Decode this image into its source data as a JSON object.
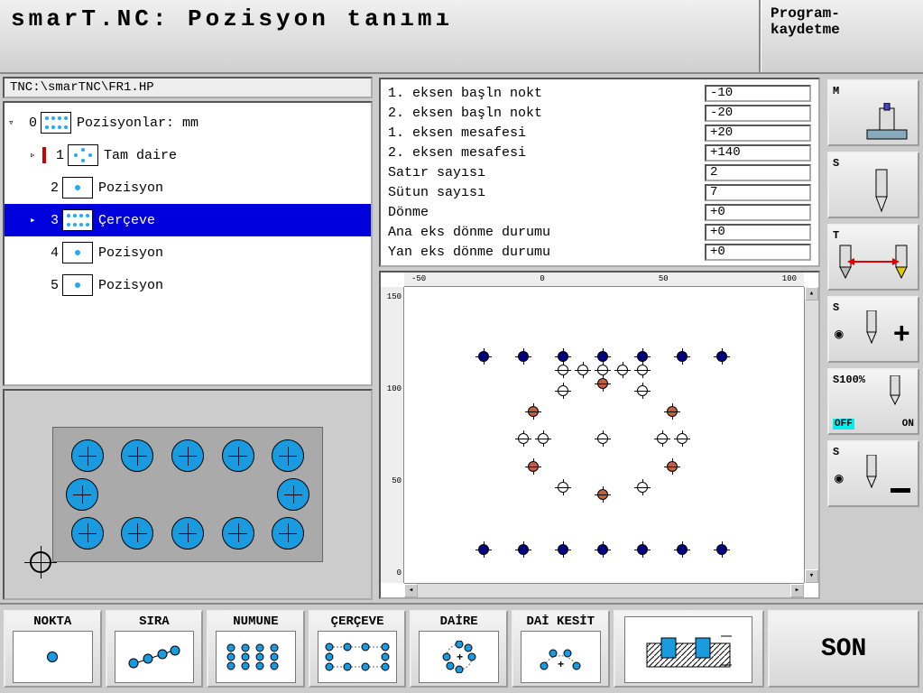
{
  "title": "smarT.NC: Pozisyon tanımı",
  "header_button": "Program-\nkaydetme",
  "path": "TNC:\\smarTNC\\FR1.HP",
  "tree": [
    {
      "num": "0",
      "label": "Pozisyonlar: mm",
      "expandable": true,
      "selected": false,
      "top": true
    },
    {
      "num": "1",
      "label": "Tam daire",
      "redmark": true
    },
    {
      "num": "2",
      "label": "Pozisyon"
    },
    {
      "num": "3",
      "label": "Çerçeve",
      "selected": true
    },
    {
      "num": "4",
      "label": "Pozisyon"
    },
    {
      "num": "5",
      "label": "Pozisyon"
    }
  ],
  "params": [
    {
      "label": "1. eksen başln nokt",
      "value": "-10"
    },
    {
      "label": "2. eksen başln nokt",
      "value": "-20"
    },
    {
      "label": "1. eksen mesafesi",
      "value": "+20"
    },
    {
      "label": "2. eksen mesafesi",
      "value": "+140"
    },
    {
      "label": "Satır sayısı",
      "value": "2"
    },
    {
      "label": "Sütun sayısı",
      "value": "7"
    },
    {
      "label": "Dönme",
      "value": "+0"
    },
    {
      "label": "Ana eks dönme durumu",
      "value": "+0"
    },
    {
      "label": "Yan eks dönme durumu",
      "value": "+0"
    }
  ],
  "ruler_x": [
    "-50",
    "0",
    "50",
    "100"
  ],
  "ruler_y": [
    "150",
    "100",
    "50",
    "0"
  ],
  "right_buttons": {
    "m": "M",
    "s": "S",
    "t": "T",
    "s_plus": "S",
    "s100": "S100%",
    "off": "OFF",
    "on": "ON",
    "s_minus": "S"
  },
  "softkeys": {
    "nokta": "NOKTA",
    "sira": "SIRA",
    "numune": "NUMUNE",
    "cerceve": "ÇERÇEVE",
    "daire": "DAİRE",
    "daikesit": "DAİ KESİT",
    "son": "SON"
  },
  "chart_data": {
    "type": "scatter",
    "description": "CNC position pattern preview combining frame, circle, and single positions",
    "xlim": [
      -50,
      130
    ],
    "ylim": [
      -30,
      170
    ],
    "series": [
      {
        "name": "frame-top-blue",
        "color": "#000080",
        "points": [
          [
            -10,
            120
          ],
          [
            10,
            120
          ],
          [
            30,
            120
          ],
          [
            50,
            120
          ],
          [
            70,
            120
          ],
          [
            90,
            120
          ],
          [
            110,
            120
          ]
        ]
      },
      {
        "name": "frame-bottom-blue",
        "color": "#000080",
        "points": [
          [
            -10,
            -20
          ],
          [
            10,
            -20
          ],
          [
            30,
            -20
          ],
          [
            50,
            -20
          ],
          [
            70,
            -20
          ],
          [
            90,
            -20
          ],
          [
            110,
            -20
          ]
        ]
      },
      {
        "name": "circle-red",
        "color": "#c06040",
        "points": [
          [
            85,
            80
          ],
          [
            85,
            40
          ],
          [
            50,
            100
          ],
          [
            50,
            20
          ],
          [
            15,
            80
          ],
          [
            15,
            40
          ]
        ]
      },
      {
        "name": "circle-white",
        "color": "#ffffff",
        "points": [
          [
            70,
            95
          ],
          [
            30,
            95
          ],
          [
            70,
            25
          ],
          [
            30,
            25
          ],
          [
            90,
            60
          ],
          [
            10,
            60
          ],
          [
            50,
            60
          ]
        ]
      },
      {
        "name": "pos-white",
        "color": "#ffffff",
        "points": [
          [
            50,
            110
          ],
          [
            30,
            110
          ],
          [
            40,
            110
          ],
          [
            60,
            110
          ],
          [
            70,
            110
          ],
          [
            20,
            60
          ],
          [
            80,
            60
          ]
        ]
      }
    ]
  }
}
